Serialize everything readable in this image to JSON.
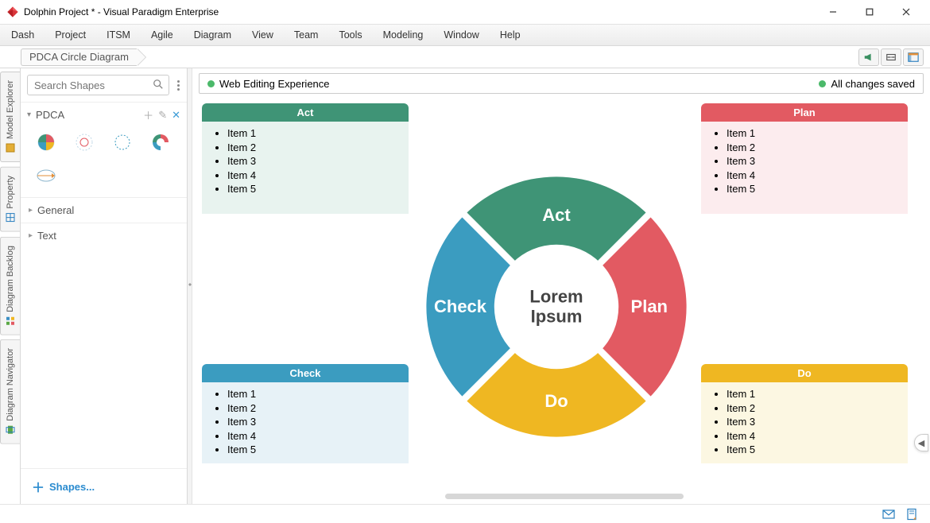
{
  "window": {
    "title": "Dolphin Project * - Visual Paradigm Enterprise"
  },
  "menu": [
    "Dash",
    "Project",
    "ITSM",
    "Agile",
    "Diagram",
    "View",
    "Team",
    "Tools",
    "Modeling",
    "Window",
    "Help"
  ],
  "breadcrumb": "PDCA Circle Diagram",
  "search_placeholder": "Search Shapes",
  "shapes_panel": {
    "title": "PDCA",
    "groups": [
      "General",
      "Text"
    ],
    "link": "Shapes..."
  },
  "side_tabs": [
    "Model Explorer",
    "Property",
    "Diagram Backlog",
    "Diagram Navigator"
  ],
  "canvas_status": {
    "left": "Web Editing Experience",
    "right": "All changes saved",
    "left_color": "#4bb96a",
    "right_color": "#4bb96a"
  },
  "pdca": {
    "center": "Lorem Ipsum",
    "segments": {
      "act": {
        "label": "Act",
        "color": "#3f9476",
        "tint": "#e8f3ef"
      },
      "plan": {
        "label": "Plan",
        "color": "#e25a62",
        "tint": "#fcecee"
      },
      "do": {
        "label": "Do",
        "color": "#efb722",
        "tint": "#fcf7e2"
      },
      "check": {
        "label": "Check",
        "color": "#3b9cc0",
        "tint": "#e7f2f7"
      }
    },
    "items": [
      "Item 1",
      "Item 2",
      "Item 3",
      "Item 4",
      "Item 5"
    ]
  }
}
